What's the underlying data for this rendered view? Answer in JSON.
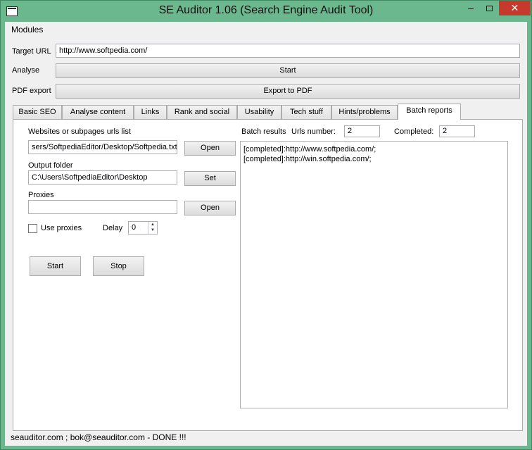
{
  "window": {
    "title": "SE Auditor 1.06 (Search Engine Audit Tool)",
    "minimize": "‒",
    "close": "✕"
  },
  "menu": {
    "modules": "Modules"
  },
  "target": {
    "label": "Target URL",
    "value": "http://www.softpedia.com/"
  },
  "analyse": {
    "label": "Analyse",
    "button": "Start"
  },
  "pdf": {
    "label": "PDF export",
    "button": "Export to PDF"
  },
  "tabs": [
    {
      "label": "Basic SEO"
    },
    {
      "label": "Analyse content"
    },
    {
      "label": "Links"
    },
    {
      "label": "Rank and social"
    },
    {
      "label": "Usability"
    },
    {
      "label": "Tech stuff"
    },
    {
      "label": "Hints/problems"
    },
    {
      "label": "Batch reports",
      "active": true
    }
  ],
  "batch": {
    "urls_list_label": "Websites or subpages urls list",
    "urls_list_value": "sers/SoftpediaEditor/Desktop/Softpedia.txt",
    "open_button": "Open",
    "output_label": "Output folder",
    "output_value": "C:\\Users\\SoftpediaEditor\\Desktop",
    "set_button": "Set",
    "proxies_label": "Proxies",
    "proxies_value": "",
    "proxies_open_button": "Open",
    "use_proxies_label": "Use proxies",
    "use_proxies_checked": false,
    "delay_label": "Delay",
    "delay_value": "0",
    "start_button": "Start",
    "stop_button": "Stop",
    "results_label": "Batch results",
    "urls_number_label": "Urls number:",
    "urls_number_value": "2",
    "completed_label": "Completed:",
    "completed_value": "2",
    "results": [
      "[completed]:http://www.softpedia.com/;",
      "[completed]:http://win.softpedia.com/;"
    ]
  },
  "status": "seauditor.com ; bok@seauditor.com - DONE !!!",
  "colors": {
    "titlebar": "#6cb88e",
    "close": "#c7382d",
    "client": "#f0f0f0"
  }
}
